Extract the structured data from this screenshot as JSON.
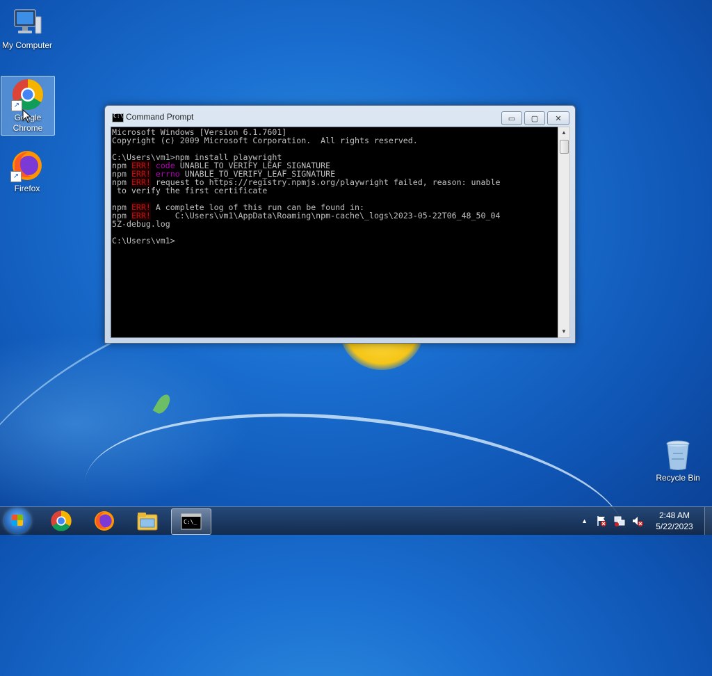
{
  "desktop": {
    "icons": [
      {
        "label": "My Computer",
        "icon": "computer-icon"
      },
      {
        "label": "Google Chrome",
        "label_lines": [
          "Google",
          "Chrome"
        ],
        "icon": "chrome-icon",
        "selected": true
      },
      {
        "label": "Firefox",
        "icon": "firefox-icon"
      },
      {
        "label": "Recycle Bin",
        "icon": "recycle-bin-icon"
      }
    ]
  },
  "cmd_window": {
    "title": "Command Prompt",
    "buttons": {
      "minimize": "▭",
      "maximize": "▢",
      "close": "✕"
    },
    "lines": {
      "l1": "Microsoft Windows [Version 6.1.7601]",
      "l2": "Copyright (c) 2009 Microsoft Corporation.  All rights reserved.",
      "l3": "C:\\Users\\vm1>npm install playwright",
      "npm": "npm",
      "err": "ERR!",
      "code_kw": "code",
      "errno_kw": "errno",
      "code_val": " UNABLE_TO_VERIFY_LEAF_SIGNATURE",
      "errno_val": " UNABLE_TO_VERIFY_LEAF_SIGNATURE",
      "req_a": " request to https://registry.npmjs.org/playwright failed, reason: unable",
      "req_b": " to verify the first certificate",
      "log_a": " A complete log of this run can be found in:",
      "log_b": "     C:\\Users\\vm1\\AppData\\Roaming\\npm-cache\\_logs\\2023-05-22T06_48_50_04",
      "log_c": "5Z-debug.log",
      "prompt": "C:\\Users\\vm1>"
    }
  },
  "taskbar": {
    "items": [
      "chrome-icon",
      "firefox-icon",
      "file-explorer-icon",
      "command-prompt-icon"
    ],
    "active": "command-prompt-icon",
    "tray": {
      "expand": "▲",
      "icons": [
        "action-center-icon",
        "network-icon",
        "volume-muted-icon"
      ]
    },
    "clock": {
      "time": "2:48 AM",
      "date": "5/22/2023"
    }
  },
  "colors": {
    "console_bg": "#000000",
    "console_text": "#c0c0c0",
    "err_red": "#c01010",
    "keyword_magenta": "#b000b0"
  }
}
